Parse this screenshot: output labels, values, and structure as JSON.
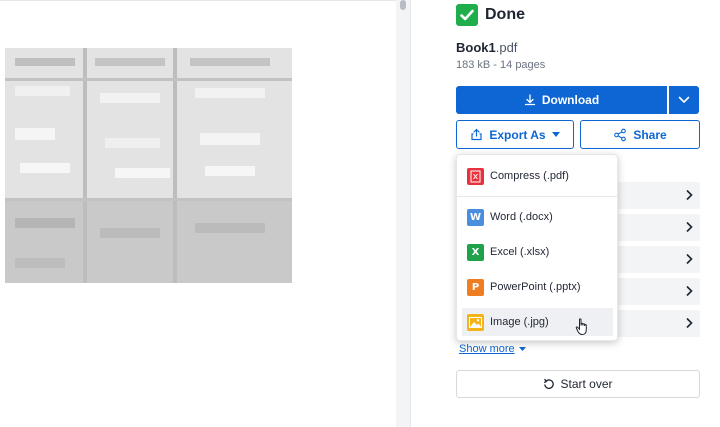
{
  "status": {
    "title": "Done",
    "icon": "check-icon",
    "color": "#1fae4b"
  },
  "file": {
    "base_name": "Book1",
    "extension": ".pdf",
    "meta": "183 kB - 14 pages"
  },
  "actions": {
    "download_label": "Download",
    "export_label": "Export As",
    "share_label": "Share",
    "show_more_label": "Show more",
    "start_over_label": "Start over"
  },
  "export_menu": {
    "items": [
      {
        "label": "Compress (.pdf)",
        "icon": "compress-pdf-icon",
        "color": "#e5323e"
      },
      {
        "label": "Word (.docx)",
        "icon": "word-icon",
        "color": "#4a8fde"
      },
      {
        "label": "Excel (.xlsx)",
        "icon": "excel-icon",
        "color": "#20a24b"
      },
      {
        "label": "PowerPoint (.pptx)",
        "icon": "powerpoint-icon",
        "color": "#ef7d22"
      },
      {
        "label": "Image (.jpg)",
        "icon": "image-icon",
        "color": "#f2b418"
      }
    ]
  },
  "colors": {
    "primary": "#0d66d4"
  }
}
